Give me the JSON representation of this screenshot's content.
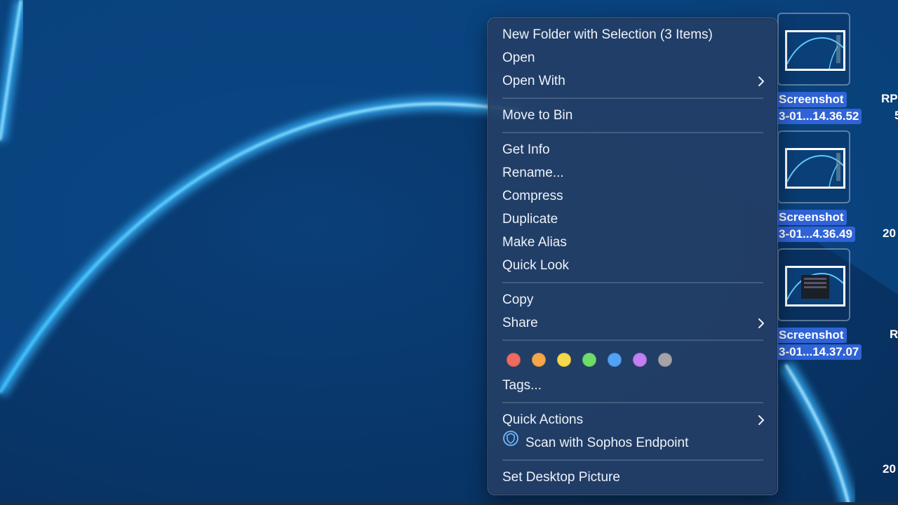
{
  "context_menu": {
    "items": [
      {
        "label": "New Folder with Selection (3 Items)"
      },
      {
        "label": "Open"
      },
      {
        "label": "Open With",
        "submenu": true
      },
      {
        "label": "Move to Bin"
      },
      {
        "label": "Get Info"
      },
      {
        "label": "Rename..."
      },
      {
        "label": "Compress"
      },
      {
        "label": "Duplicate"
      },
      {
        "label": "Make Alias"
      },
      {
        "label": "Quick Look"
      },
      {
        "label": "Copy"
      },
      {
        "label": "Share",
        "submenu": true
      },
      {
        "label": "Tags..."
      },
      {
        "label": "Quick Actions",
        "submenu": true
      },
      {
        "label": "Scan with Sophos Endpoint",
        "icon": "sophos-shield-icon"
      },
      {
        "label": "Set Desktop Picture"
      }
    ],
    "tag_colors": [
      "#ef6b60",
      "#f5a64a",
      "#f5d94a",
      "#6fdc6a",
      "#52a2f5",
      "#c37ef2",
      "#a4a4a8"
    ]
  },
  "desktop": {
    "icons": [
      {
        "line1": "Screenshot",
        "line2": "3-01...14.36.52"
      },
      {
        "line1": "Screenshot",
        "line2": "3-01...4.36.49"
      },
      {
        "line1": "Screenshot",
        "line2": "3-01...14.37.07"
      }
    ],
    "partial_labels": [
      "RP",
      "5",
      "20",
      "R",
      "20"
    ]
  }
}
